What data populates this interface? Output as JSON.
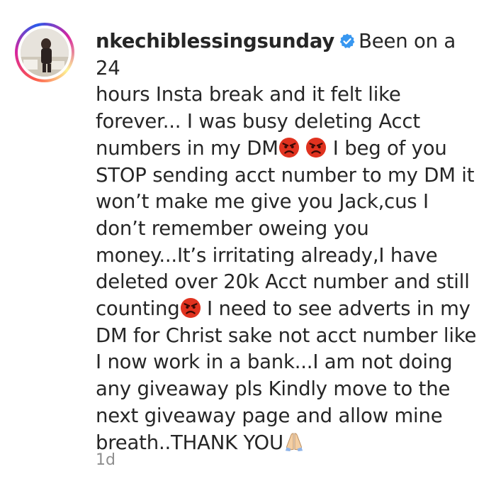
{
  "post": {
    "username": "nkechiblessingsunday",
    "caption_segments": [
      "Been on a 24\nhours Insta break and it felt like\nforever... I was busy deleting Acct\nnumbers in my DM",
      " I beg of you\nSTOP sending acct number to my DM it\nwon’t make me give you Jack,cus I\ndon’t remember oweing you\nmoney...It’s irritating already,I have\ndeleted over 20k Acct number and still\ncounting",
      " I need to see adverts in my\nDM for Christ sake not acct number like\nI now work in a bank...I am not doing\nany giveaway pls Kindly move to the\nnext giveaway page and allow mine\nbreath..THANK YOU"
    ],
    "timestamp": "1d",
    "icons": {
      "verified": "verified-badge-icon",
      "angry": "angry-face-emoji",
      "pray": "folded-hands-emoji"
    },
    "colors": {
      "text": "#262626",
      "muted": "#8e8e8e",
      "verified_blue": "#3897f0",
      "angry_red": "#e0321f"
    }
  }
}
